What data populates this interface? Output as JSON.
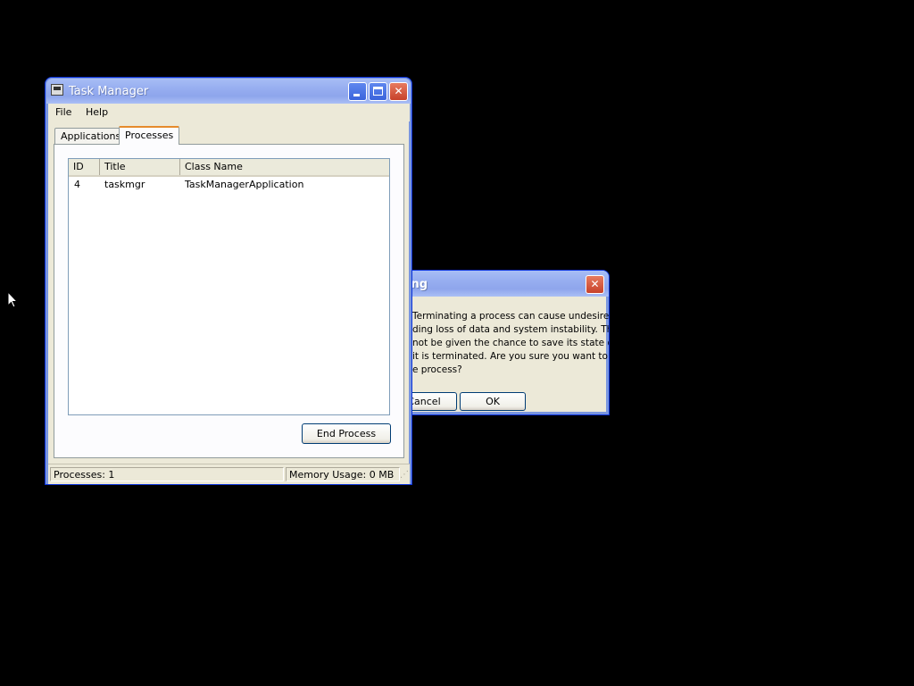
{
  "task_manager": {
    "title": "Task Manager",
    "menu": [
      "File",
      "Help"
    ],
    "tabs": [
      "Applications",
      "Processes"
    ],
    "active_tab": "Processes",
    "columns": [
      "ID",
      "Title",
      "Class Name"
    ],
    "rows": [
      {
        "id": "4",
        "title": "taskmgr",
        "class_name": "TaskManagerApplication"
      }
    ],
    "end_process_label": "End Process",
    "status": {
      "processes": "Processes: 1",
      "memory": "Memory Usage: 0 MB"
    }
  },
  "warning_dialog": {
    "title_fragment": "ing",
    "message_lines": [
      "Terminating a process can cause undesired",
      "ding loss of data and system instability. The",
      "not be given the chance to save its state or",
      "it is terminated. Are you sure you want to",
      "e process?"
    ],
    "cancel_label": "Cancel",
    "ok_label": "OK"
  },
  "colors": {
    "desktop": "#000000",
    "window_face": "#ece9d8",
    "titlebar_inactive": "#97aef0",
    "active_tab_accent": "#e68b2c"
  }
}
